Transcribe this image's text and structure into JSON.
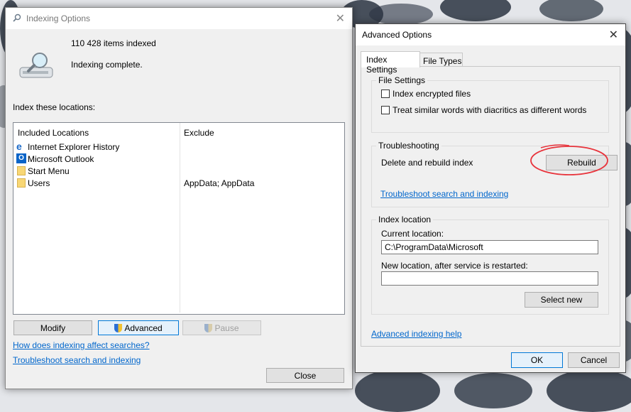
{
  "indexing": {
    "title": "Indexing Options",
    "items_indexed": "110 428 items indexed",
    "status": "Indexing complete.",
    "locations_label": "Index these locations:",
    "columns": {
      "included": "Included Locations",
      "exclude": "Exclude"
    },
    "locations": [
      {
        "name": "Internet Explorer History",
        "exclude": ""
      },
      {
        "name": "Microsoft Outlook",
        "exclude": ""
      },
      {
        "name": "Start Menu",
        "exclude": ""
      },
      {
        "name": "Users",
        "exclude": "AppData; AppData"
      }
    ],
    "buttons": {
      "modify": "Modify",
      "advanced": "Advanced",
      "pause": "Pause",
      "close": "Close"
    },
    "links": {
      "how": "How does indexing affect searches?",
      "troubleshoot": "Troubleshoot search and indexing"
    }
  },
  "advanced": {
    "title": "Advanced Options",
    "tabs": {
      "index_settings": "Index Settings",
      "file_types": "File Types"
    },
    "file_settings": {
      "label": "File Settings",
      "encrypt": "Index encrypted files",
      "diacritics": "Treat similar words with diacritics as different words"
    },
    "troubleshooting": {
      "label": "Troubleshooting",
      "delete_rebuild": "Delete and rebuild index",
      "rebuild": "Rebuild",
      "link": "Troubleshoot search and indexing"
    },
    "index_location": {
      "label": "Index location",
      "current_label": "Current location:",
      "current_value": "C:\\ProgramData\\Microsoft",
      "new_label": "New location, after service is restarted:",
      "new_value": "",
      "select_new": "Select new"
    },
    "help_link": "Advanced indexing help",
    "ok": "OK",
    "cancel": "Cancel"
  },
  "colors": {
    "accent": "#0078d7",
    "link": "#0066cc",
    "highlight": "#e8343c"
  }
}
